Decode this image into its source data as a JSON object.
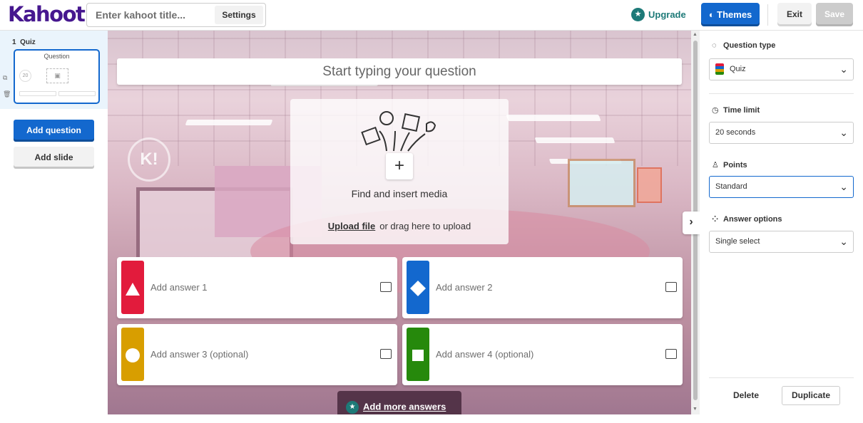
{
  "header": {
    "logo": "Kahoot!",
    "title_placeholder": "Enter kahoot title...",
    "settings_label": "Settings",
    "upgrade_label": "Upgrade",
    "themes_label": "Themes",
    "exit_label": "Exit",
    "save_label": "Save"
  },
  "sidebar": {
    "slide": {
      "number": "1",
      "type": "Quiz",
      "thumb_title": "Question",
      "thumb_timer": "20"
    },
    "add_question_label": "Add question",
    "add_slide_label": "Add slide"
  },
  "editor": {
    "question_placeholder": "Start typing your question",
    "media": {
      "find_label": "Find and insert media",
      "upload_label": "Upload file",
      "drag_label": "or drag here to upload"
    },
    "answers": [
      {
        "label": "Add answer 1",
        "color": "#e21b3c",
        "shape": "triangle"
      },
      {
        "label": "Add answer 2",
        "color": "#1368ce",
        "shape": "diamond"
      },
      {
        "label": "Add answer 3 (optional)",
        "color": "#d89e00",
        "shape": "circle"
      },
      {
        "label": "Add answer 4 (optional)",
        "color": "#26890c",
        "shape": "square"
      }
    ],
    "add_more_label": "Add more answers"
  },
  "settings_panel": {
    "question_type": {
      "title": "Question type",
      "value": "Quiz"
    },
    "time_limit": {
      "title": "Time limit",
      "value": "20 seconds"
    },
    "points": {
      "title": "Points",
      "value": "Standard"
    },
    "answer_options": {
      "title": "Answer options",
      "value": "Single select"
    },
    "delete_label": "Delete",
    "duplicate_label": "Duplicate"
  },
  "colors": {
    "brand": "#46178f",
    "primary": "#1368ce",
    "teal": "#1d7a78"
  }
}
